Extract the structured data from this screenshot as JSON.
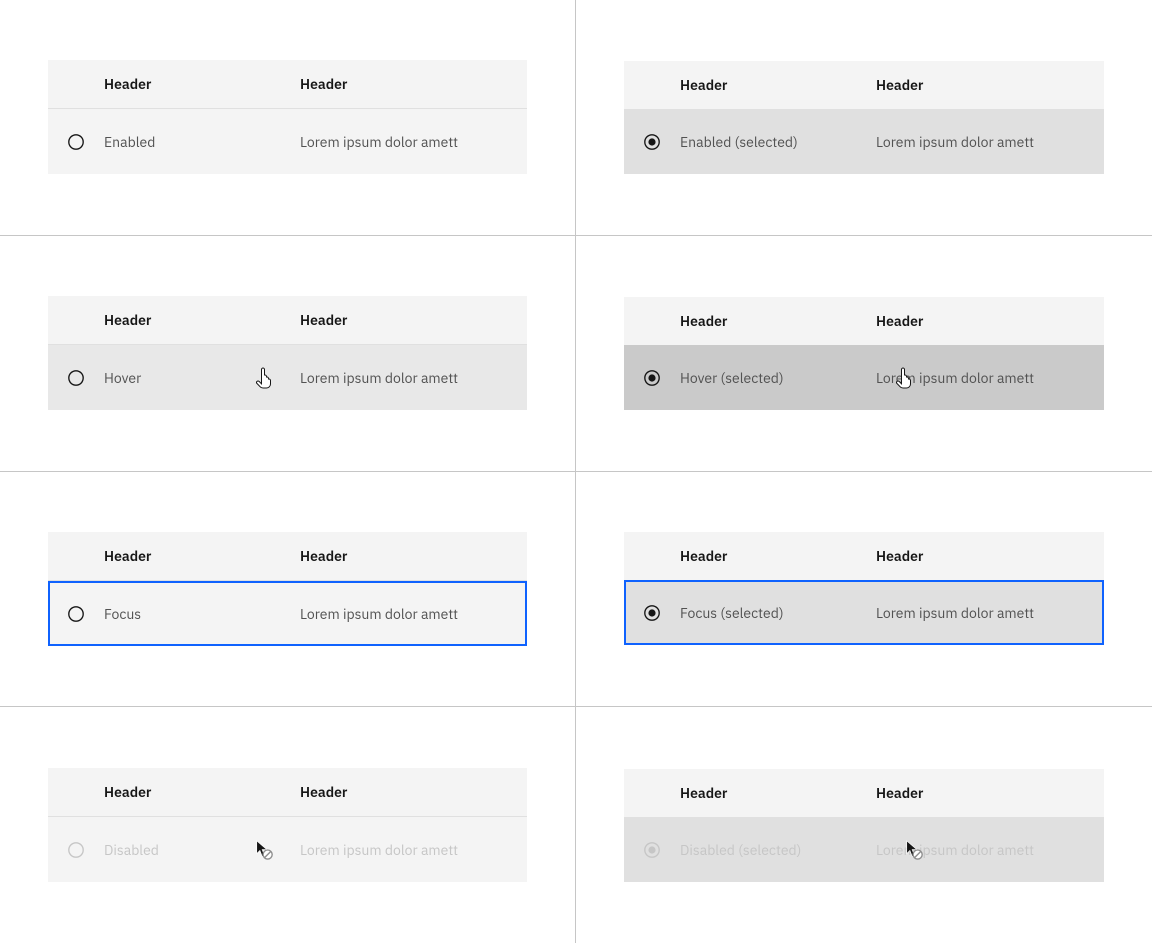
{
  "headers": {
    "h1": "Header",
    "h2": "Header"
  },
  "content": "Lorem ipsum dolor amett",
  "states": {
    "enabled": "Enabled",
    "enabled_selected": "Enabled (selected)",
    "hover": "Hover",
    "hover_selected": "Hover (selected)",
    "focus": "Focus",
    "focus_selected": "Focus (selected)",
    "disabled": "Disabled",
    "disabled_selected": "Disabled (selected)"
  }
}
